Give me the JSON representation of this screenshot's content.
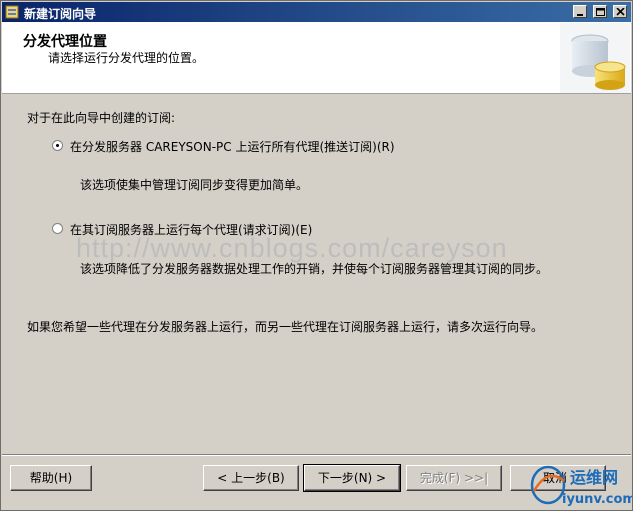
{
  "window": {
    "title": "新建订阅向导"
  },
  "header": {
    "title": "分发代理位置",
    "subtitle": "请选择运行分发代理的位置。"
  },
  "content": {
    "question": "对于在此向导中创建的订阅:",
    "options": [
      {
        "label": "在分发服务器 CAREYSON-PC 上运行所有代理(推送订阅)(R)",
        "description": "该选项使集中管理订阅同步变得更加简单。",
        "selected": true
      },
      {
        "label": "在其订阅服务器上运行每个代理(请求订阅)(E)",
        "description": "该选项降低了分发服务器数据处理工作的开销，并使每个订阅服务器管理其订阅的同步。",
        "selected": false
      }
    ],
    "note": "如果您希望一些代理在分发服务器上运行，而另一些代理在订阅服务器上运行，请多次运行向导。"
  },
  "watermark": "http://www.cnblogs.com/careyson",
  "buttons": {
    "help": "帮助(H)",
    "back": "< 上一步(B)",
    "next": "下一步(N) >",
    "finish": "完成(F) >>|",
    "cancel": "取消"
  },
  "logo": {
    "text_cn": "运维网",
    "text_url": "iyunv.com"
  },
  "colors": {
    "titlebar_start": "#0a246a",
    "titlebar_end": "#3a6ea5",
    "dialog_bg": "#d4d0c8",
    "watermark": "#bdbdbd"
  }
}
